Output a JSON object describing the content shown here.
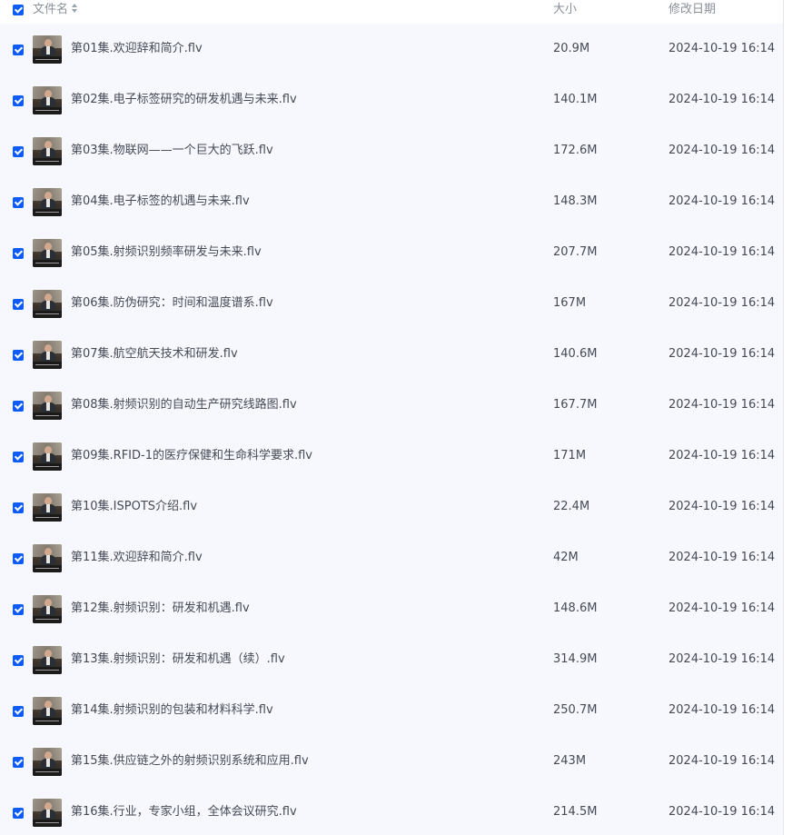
{
  "header": {
    "name_label": "文件名",
    "size_label": "大小",
    "date_label": "修改日期"
  },
  "colors": {
    "accent": "#0d5cf5",
    "row_background": "#f7f8fe",
    "text": "#454a55",
    "header_text": "#8a8f99"
  },
  "files": [
    {
      "name": "第01集.欢迎辞和简介.flv",
      "size": "20.9M",
      "modified": "2024-10-19 16:14",
      "checked": true
    },
    {
      "name": "第02集.电子标签研究的研发机遇与未来.flv",
      "size": "140.1M",
      "modified": "2024-10-19 16:14",
      "checked": true
    },
    {
      "name": "第03集.物联网——一个巨大的飞跃.flv",
      "size": "172.6M",
      "modified": "2024-10-19 16:14",
      "checked": true
    },
    {
      "name": "第04集.电子标签的机遇与未来.flv",
      "size": "148.3M",
      "modified": "2024-10-19 16:14",
      "checked": true
    },
    {
      "name": "第05集.射频识别频率研发与未来.flv",
      "size": "207.7M",
      "modified": "2024-10-19 16:14",
      "checked": true
    },
    {
      "name": "第06集.防伪研究：时间和温度谱系.flv",
      "size": "167M",
      "modified": "2024-10-19 16:14",
      "checked": true
    },
    {
      "name": "第07集.航空航天技术和研发.flv",
      "size": "140.6M",
      "modified": "2024-10-19 16:14",
      "checked": true
    },
    {
      "name": "第08集.射频识别的自动生产研究线路图.flv",
      "size": "167.7M",
      "modified": "2024-10-19 16:14",
      "checked": true
    },
    {
      "name": "第09集.RFID-1的医疗保健和生命科学要求.flv",
      "size": "171M",
      "modified": "2024-10-19 16:14",
      "checked": true
    },
    {
      "name": "第10集.ISPOTS介绍.flv",
      "size": "22.4M",
      "modified": "2024-10-19 16:14",
      "checked": true
    },
    {
      "name": "第11集.欢迎辞和简介.flv",
      "size": "42M",
      "modified": "2024-10-19 16:14",
      "checked": true
    },
    {
      "name": "第12集.射频识别：研发和机遇.flv",
      "size": "148.6M",
      "modified": "2024-10-19 16:14",
      "checked": true
    },
    {
      "name": "第13集.射频识别：研发和机遇（续）.flv",
      "size": "314.9M",
      "modified": "2024-10-19 16:14",
      "checked": true
    },
    {
      "name": "第14集.射频识别的包装和材料科学.flv",
      "size": "250.7M",
      "modified": "2024-10-19 16:14",
      "checked": true
    },
    {
      "name": "第15集.供应链之外的射频识别系统和应用.flv",
      "size": "243M",
      "modified": "2024-10-19 16:14",
      "checked": true
    },
    {
      "name": "第16集.行业，专家小组，全体会议研究.flv",
      "size": "214.5M",
      "modified": "2024-10-19 16:14",
      "checked": true
    }
  ]
}
